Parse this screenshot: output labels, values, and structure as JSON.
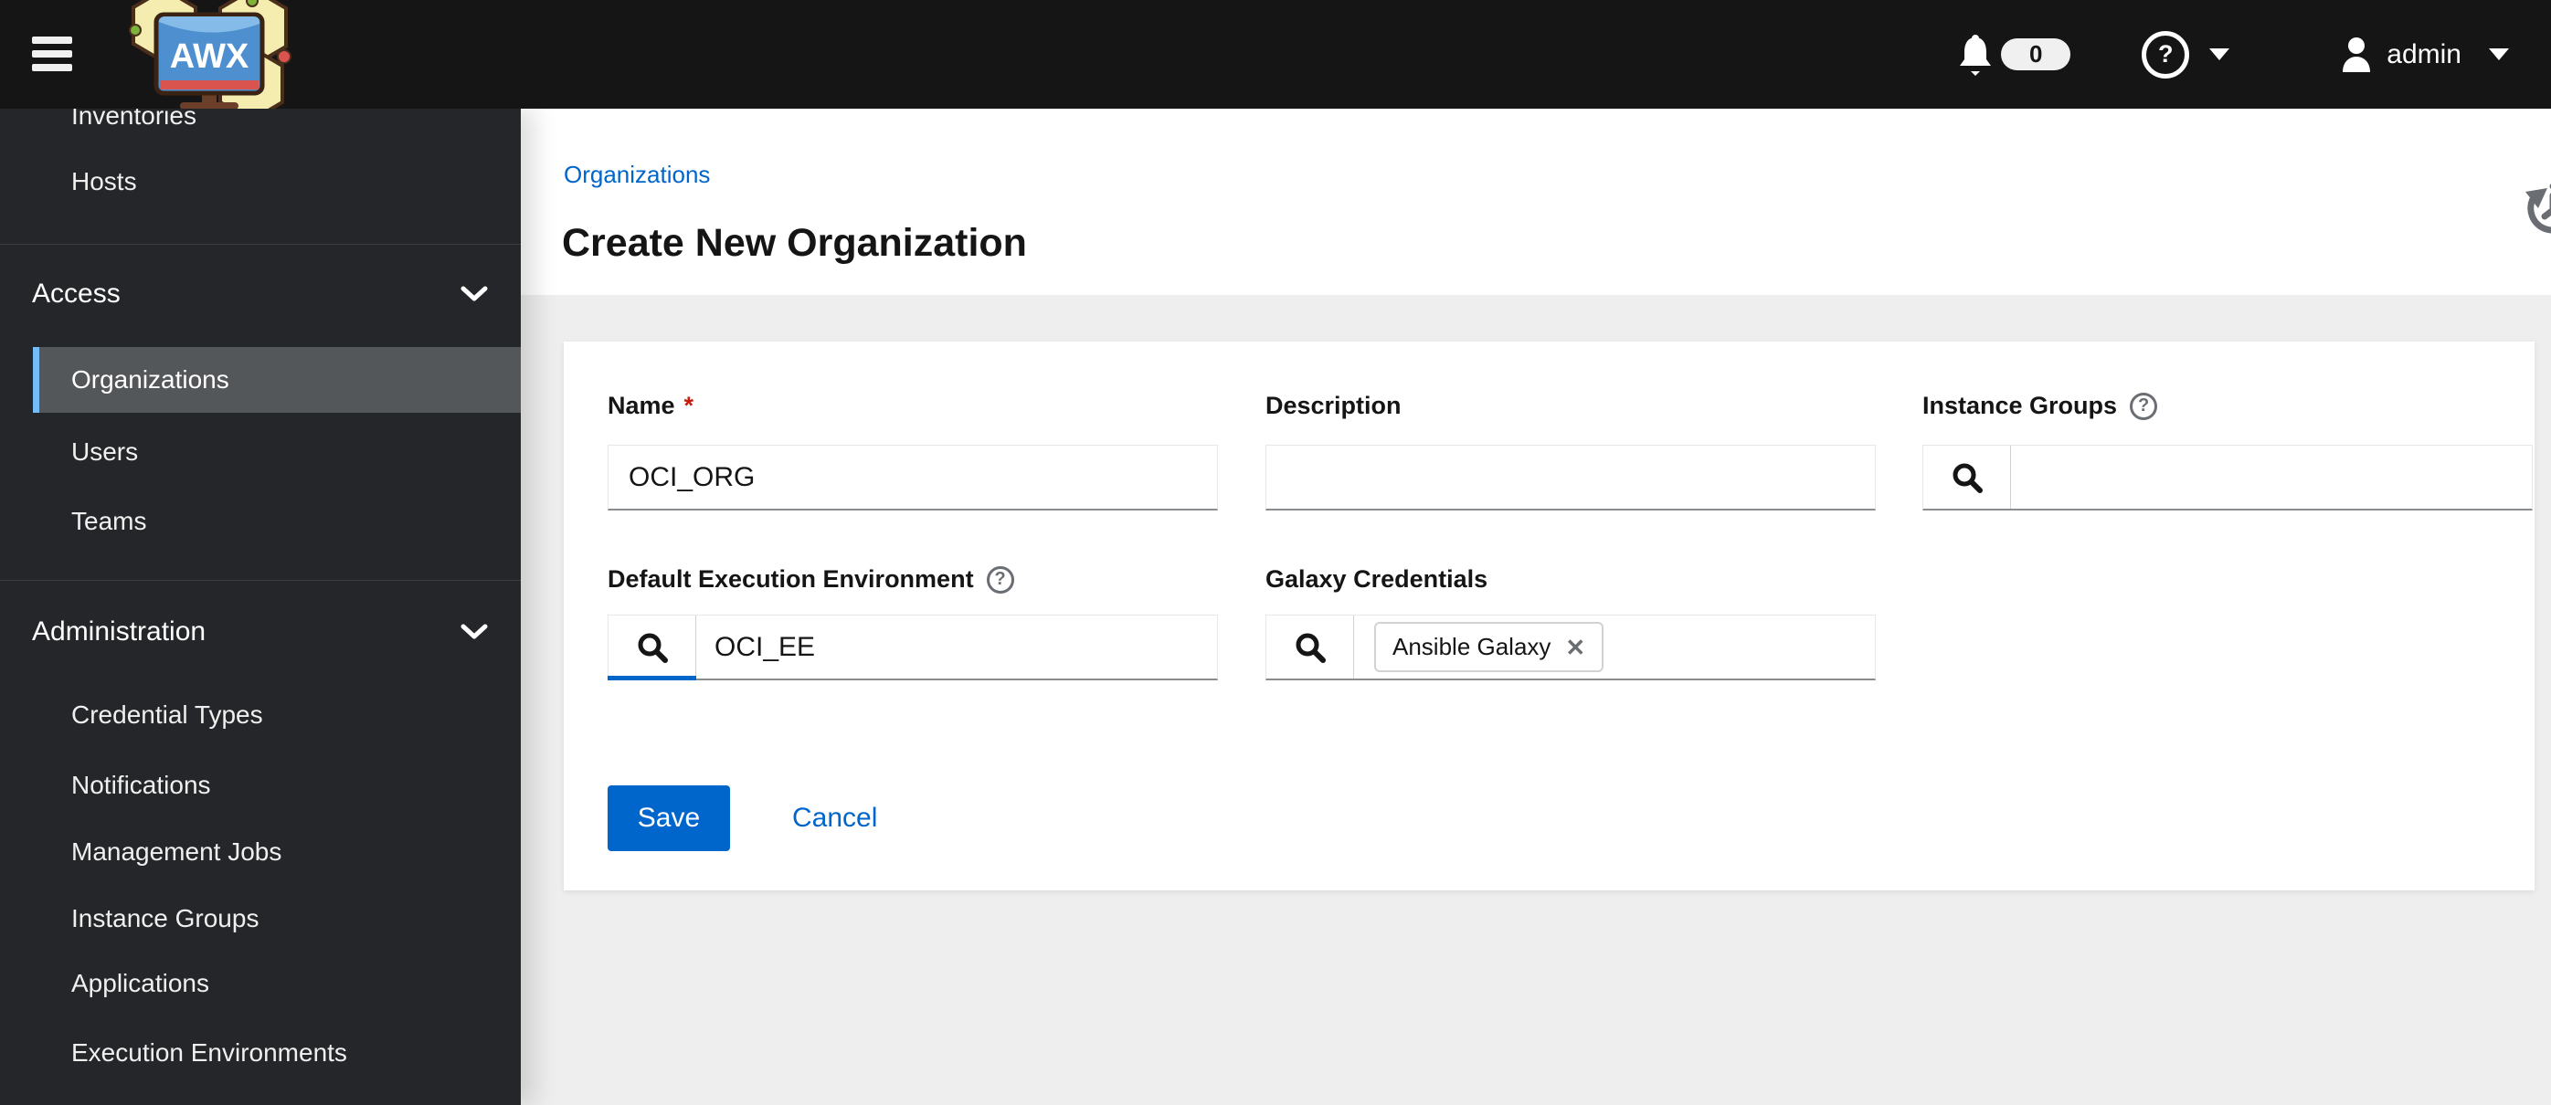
{
  "header": {
    "brand": "AWX",
    "notifications": {
      "count": "0"
    },
    "user": {
      "name": "admin"
    }
  },
  "sidebar": {
    "top_items": [
      {
        "label": "Inventories"
      },
      {
        "label": "Hosts"
      }
    ],
    "groups": [
      {
        "label": "Access",
        "items": [
          {
            "label": "Organizations",
            "selected": true
          },
          {
            "label": "Users"
          },
          {
            "label": "Teams"
          }
        ]
      },
      {
        "label": "Administration",
        "items": [
          {
            "label": "Credential Types"
          },
          {
            "label": "Notifications"
          },
          {
            "label": "Management Jobs"
          },
          {
            "label": "Instance Groups"
          },
          {
            "label": "Applications"
          },
          {
            "label": "Execution Environments"
          }
        ]
      }
    ]
  },
  "breadcrumb": {
    "items": [
      {
        "label": "Organizations"
      }
    ]
  },
  "page": {
    "title": "Create New Organization"
  },
  "form": {
    "name": {
      "label": "Name",
      "required": true,
      "value": "OCI_ORG"
    },
    "description": {
      "label": "Description",
      "value": ""
    },
    "instance_groups": {
      "label": "Instance Groups",
      "value": ""
    },
    "default_execution_environment": {
      "label": "Default Execution Environment",
      "value": "OCI_EE"
    },
    "galaxy_credentials": {
      "label": "Galaxy Credentials",
      "chips": [
        {
          "label": "Ansible Galaxy"
        }
      ]
    },
    "actions": {
      "save": "Save",
      "cancel": "Cancel"
    }
  },
  "icons": {
    "required_marker": "*",
    "help_glyph": "?",
    "close_glyph": "✕"
  },
  "colors": {
    "accent_blue": "#0066cc",
    "selected_border_blue": "#73bcf7",
    "required_red": "#c9190b",
    "masthead_black": "#151515",
    "sidebar_dark": "#242629",
    "selected_row_gray": "#54575a",
    "content_gray": "#eeeeee"
  }
}
